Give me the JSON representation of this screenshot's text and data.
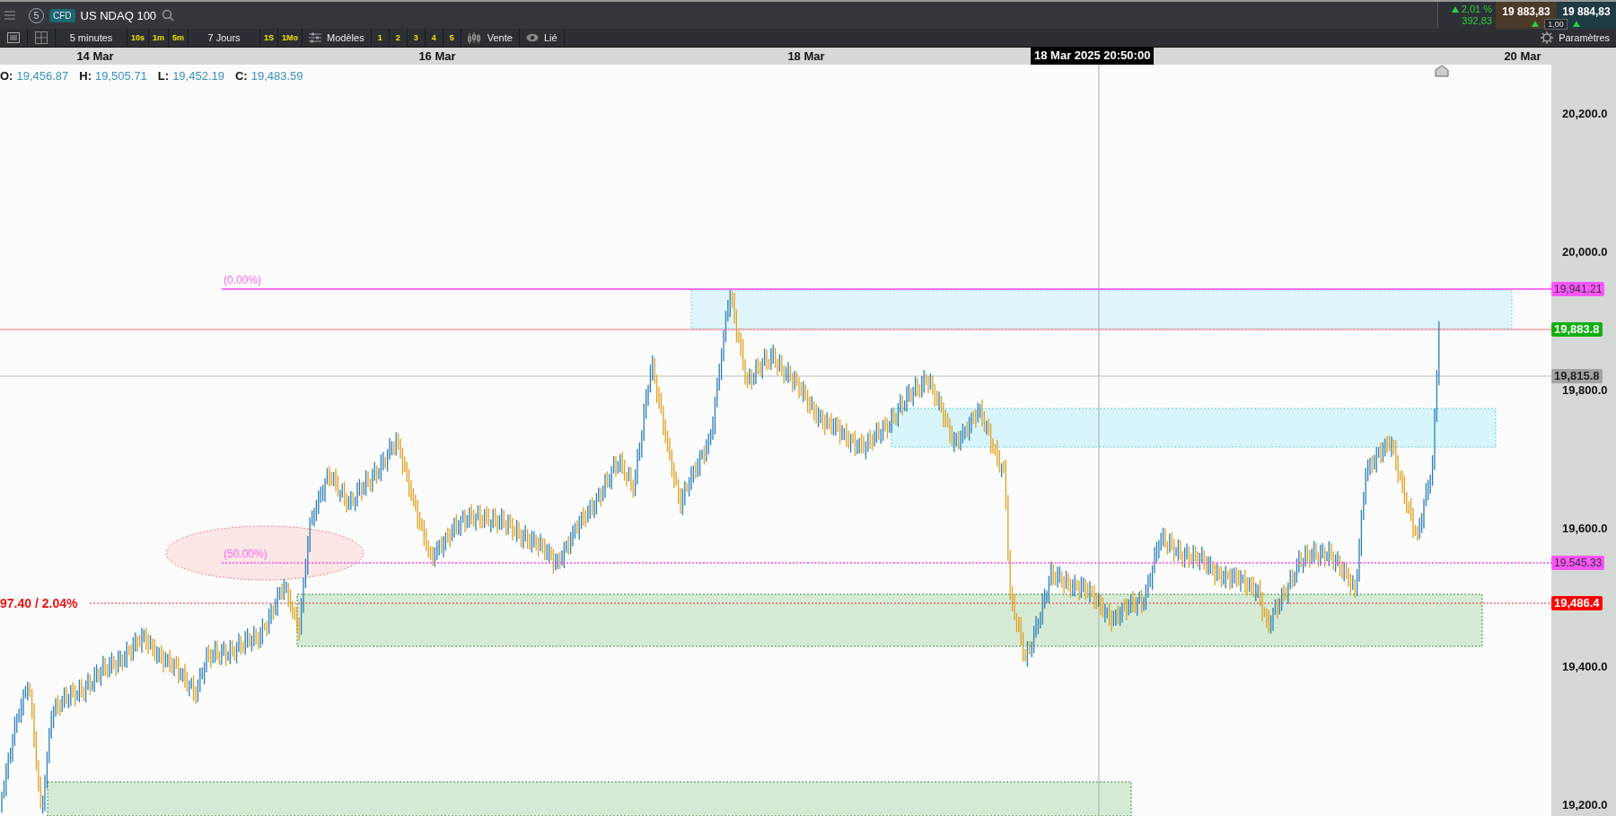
{
  "top_bar": {
    "badge_number": "5",
    "instrument_type": "CFD",
    "instrument": "US NDAQ 100",
    "change_percent": "2,01 %",
    "change_points": "392,83",
    "sell_price": "19 883,83",
    "spread": "1,00",
    "buy_price": "19 884,83"
  },
  "toolbar": {
    "interval": "5 minutes",
    "interval_buttons": [
      "10s",
      "1m",
      "5m"
    ],
    "range": "7 Jours",
    "range_buttons": [
      "1S",
      "1Mo"
    ],
    "templates": "Modèles",
    "slots": [
      "1",
      "2",
      "3",
      "4",
      "5"
    ],
    "chart_type": "Vente",
    "link": "Lié",
    "settings": "Paramètres"
  },
  "date_axis": [
    "14 Mar",
    "16 Mar",
    "18 Mar",
    "20 Mar"
  ],
  "crosshair_time": "18 Mar 2025 20:50:00",
  "ohlc": [
    {
      "label": "O:",
      "value": "19,456.87"
    },
    {
      "label": "H:",
      "value": "19,505.71"
    },
    {
      "label": "L:",
      "value": "19,452.19"
    },
    {
      "label": "C:",
      "value": "19,483.59"
    }
  ],
  "price_axis": [
    "20,200.0",
    "20,000.0",
    "19,800.0",
    "19,600.0",
    "19,400.0",
    "19,200.0"
  ],
  "price_markers": [
    {
      "label": "19,941.21",
      "color": "#ff55ff"
    },
    {
      "label": "19,883.8",
      "color": "#10b010"
    },
    {
      "label": "19,815.8",
      "color": "#a0a4a4"
    },
    {
      "label": "19,545.33",
      "color": "#ff55ff"
    },
    {
      "label": "19,486.4",
      "color": "#ff0000"
    }
  ],
  "fib_levels": [
    "(0.00%)",
    "(50.00%)"
  ],
  "alert_label": "97.40 / 2.04%"
}
